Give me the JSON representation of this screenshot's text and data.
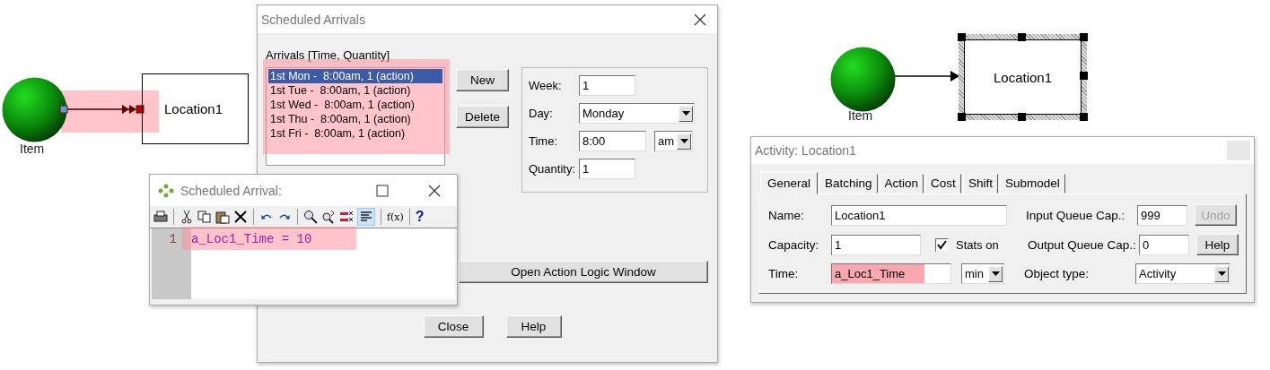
{
  "left_diagram": {
    "entity_label": "Item",
    "location_label": "Location1",
    "highlighted": true
  },
  "scheduled_arrivals": {
    "title": "Scheduled Arrivals",
    "list_label": "Arrivals [Time, Quantity]",
    "list_highlighted": true,
    "arrivals": [
      {
        "text": "1st Mon -  8:00am, 1 (action)",
        "selected": true
      },
      {
        "text": "1st Tue -  8:00am, 1 (action)",
        "selected": false
      },
      {
        "text": "1st Wed -  8:00am, 1 (action)",
        "selected": false
      },
      {
        "text": "1st Thu -  8:00am, 1 (action)",
        "selected": false
      },
      {
        "text": "1st Fri -  8:00am, 1 (action)",
        "selected": false
      }
    ],
    "new_button": "New",
    "delete_button": "Delete",
    "week_label": "Week:",
    "week": "1",
    "day_label": "Day:",
    "day": "Monday",
    "time_label": "Time:",
    "time": "8:00",
    "ampm": "am",
    "quantity_label": "Quantity:",
    "quantity": "1",
    "logic_button": "Open Action Logic Window",
    "close_button": "Close",
    "help_button": "Help"
  },
  "logic_window": {
    "title": "Scheduled Arrival:",
    "function_glyph": "f(x)",
    "help_glyph": "?",
    "format_active": true,
    "line_number": "1",
    "code": "a_Loc1_Time = 10",
    "code_highlighted": true
  },
  "right_diagram": {
    "entity_label": "Item",
    "location_label": "Location1",
    "selected": true
  },
  "activity": {
    "title": "Activity: Location1",
    "tabs": [
      {
        "label": "General",
        "selected": true
      },
      {
        "label": "Batching",
        "selected": false
      },
      {
        "label": "Action",
        "selected": false
      },
      {
        "label": "Cost",
        "selected": false
      },
      {
        "label": "Shift",
        "selected": false
      },
      {
        "label": "Submodel",
        "selected": false
      }
    ],
    "name_label": "Name:",
    "name": "Location1",
    "capacity_label": "Capacity:",
    "capacity": "1",
    "stats_label": "Stats on",
    "stats_on": true,
    "time_label": "Time:",
    "time": "a_Loc1_Time",
    "time_highlighted": true,
    "time_unit": "min",
    "input_queue_label": "Input Queue Cap.:",
    "input_queue": "999",
    "undo_button": "Undo",
    "undo_disabled": true,
    "output_queue_label": "Output Queue Cap.:",
    "output_queue": "0",
    "help_button": "Help",
    "object_type_label": "Object type:",
    "object_type": "Activity"
  }
}
